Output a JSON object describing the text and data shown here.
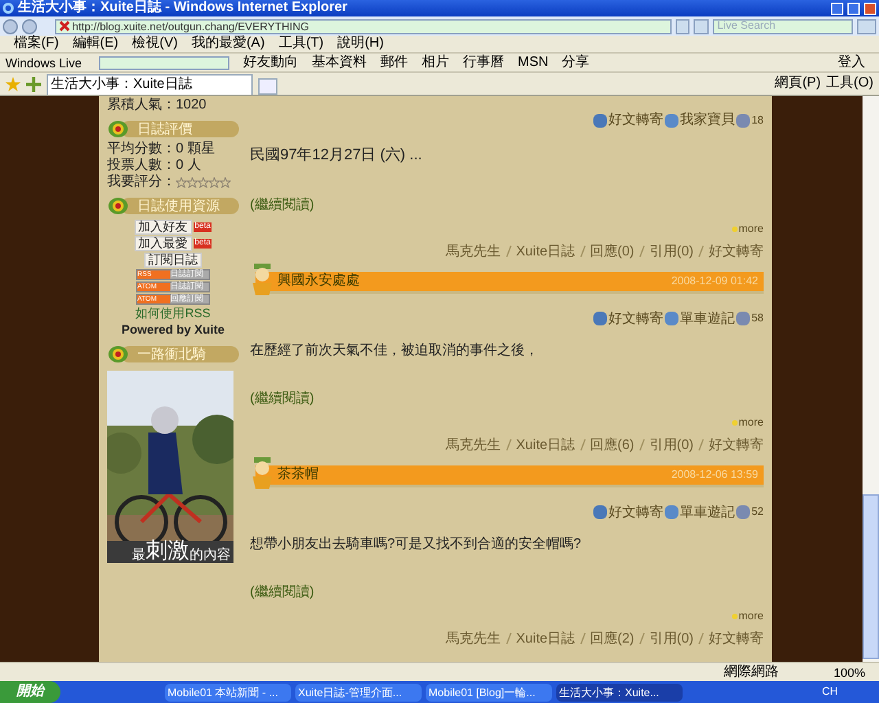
{
  "window": {
    "title": "生活大小事：Xuite日誌 - Windows Internet Explorer"
  },
  "address_bar": {
    "url": "http://blog.xuite.net/outgun.chang/EVERYTHING",
    "search_placeholder": "Live Search"
  },
  "menu": [
    "檔案(F)",
    "編輯(E)",
    "檢視(V)",
    "我的最愛(A)",
    "工具(T)",
    "說明(H)"
  ],
  "live_toolbar": {
    "brand": "Windows Live",
    "links": [
      "好友動向",
      "基本資料",
      "郵件",
      "相片",
      "行事曆",
      "MSN",
      "分享"
    ],
    "sign_in": "登入"
  },
  "tabs": [
    {
      "label": "生活大小事：Xuite日誌",
      "selected": true
    }
  ],
  "commands": [
    "網頁(P)",
    "工具(O)"
  ],
  "sidebar": {
    "visits": "累積人氣：1020",
    "rating": {
      "title": "日誌評價",
      "lines": [
        "平均分數：0 顆星",
        "投票人數：0 人"
      ],
      "vote_label": "我要評分：",
      "stars": 0
    },
    "resources": {
      "title": "日誌使用資源",
      "buttons": [
        {
          "label": "加入好友",
          "badge": "beta"
        },
        {
          "label": "加入最愛",
          "badge": "beta"
        },
        {
          "label": "訂閱日誌"
        }
      ],
      "feeds": [
        {
          "tag": "RSS",
          "label": "日誌訂閱"
        },
        {
          "tag": "ATOM",
          "label": "日誌訂閱"
        },
        {
          "tag": "ATOM",
          "label": "回應訂閱"
        }
      ],
      "rss_help": "如何使用RSS",
      "powered": "Powered by Xuite"
    },
    "banner": {
      "title": "一路衝北騎",
      "caption_small": "最",
      "caption_big": "刺激",
      "caption_end": "的內容"
    }
  },
  "posts": [
    {
      "actions": [
        "好文轉寄",
        "我家寶貝"
      ],
      "views": "18",
      "excerpt": "民國97年12月27日 (六) ...",
      "read_more": "(繼續閱讀)",
      "more": "more",
      "footer": [
        "馬克先生",
        "Xuite日誌",
        "回應(0)",
        "引用(0)",
        "好文轉寄"
      ]
    },
    {
      "title": "興國永安處處",
      "date": "2008-12-09 01:42",
      "actions": [
        "好文轉寄",
        "單車遊記"
      ],
      "views": "58",
      "excerpt": "在歷經了前次天氣不佳，被迫取消的事件之後，",
      "read_more": "(繼續閱讀)",
      "more": "more",
      "footer": [
        "馬克先生",
        "Xuite日誌",
        "回應(6)",
        "引用(0)",
        "好文轉寄"
      ]
    },
    {
      "title": "茶茶帽",
      "date": "2008-12-06 13:59",
      "actions": [
        "好文轉寄",
        "單車遊記"
      ],
      "views": "52",
      "excerpt": "想帶小朋友出去騎車嗎?可是又找不到合適的安全帽嗎?",
      "read_more": "(繼續閱讀)",
      "more": "more",
      "footer": [
        "馬克先生",
        "Xuite日誌",
        "回應(2)",
        "引用(0)",
        "好文轉寄"
      ]
    }
  ],
  "status_bar": {
    "zone": "網際網路",
    "zoom": "100%"
  },
  "taskbar": {
    "start": "開始",
    "tasks": [
      {
        "label": "Mobile01 本站新聞 - ...",
        "selected": false
      },
      {
        "label": "Xuite日誌-管理介面...",
        "selected": false
      },
      {
        "label": "Mobile01 [Blog]一輪...",
        "selected": false
      },
      {
        "label": "生活大小事：Xuite...",
        "selected": true
      }
    ],
    "lang": "CH"
  }
}
